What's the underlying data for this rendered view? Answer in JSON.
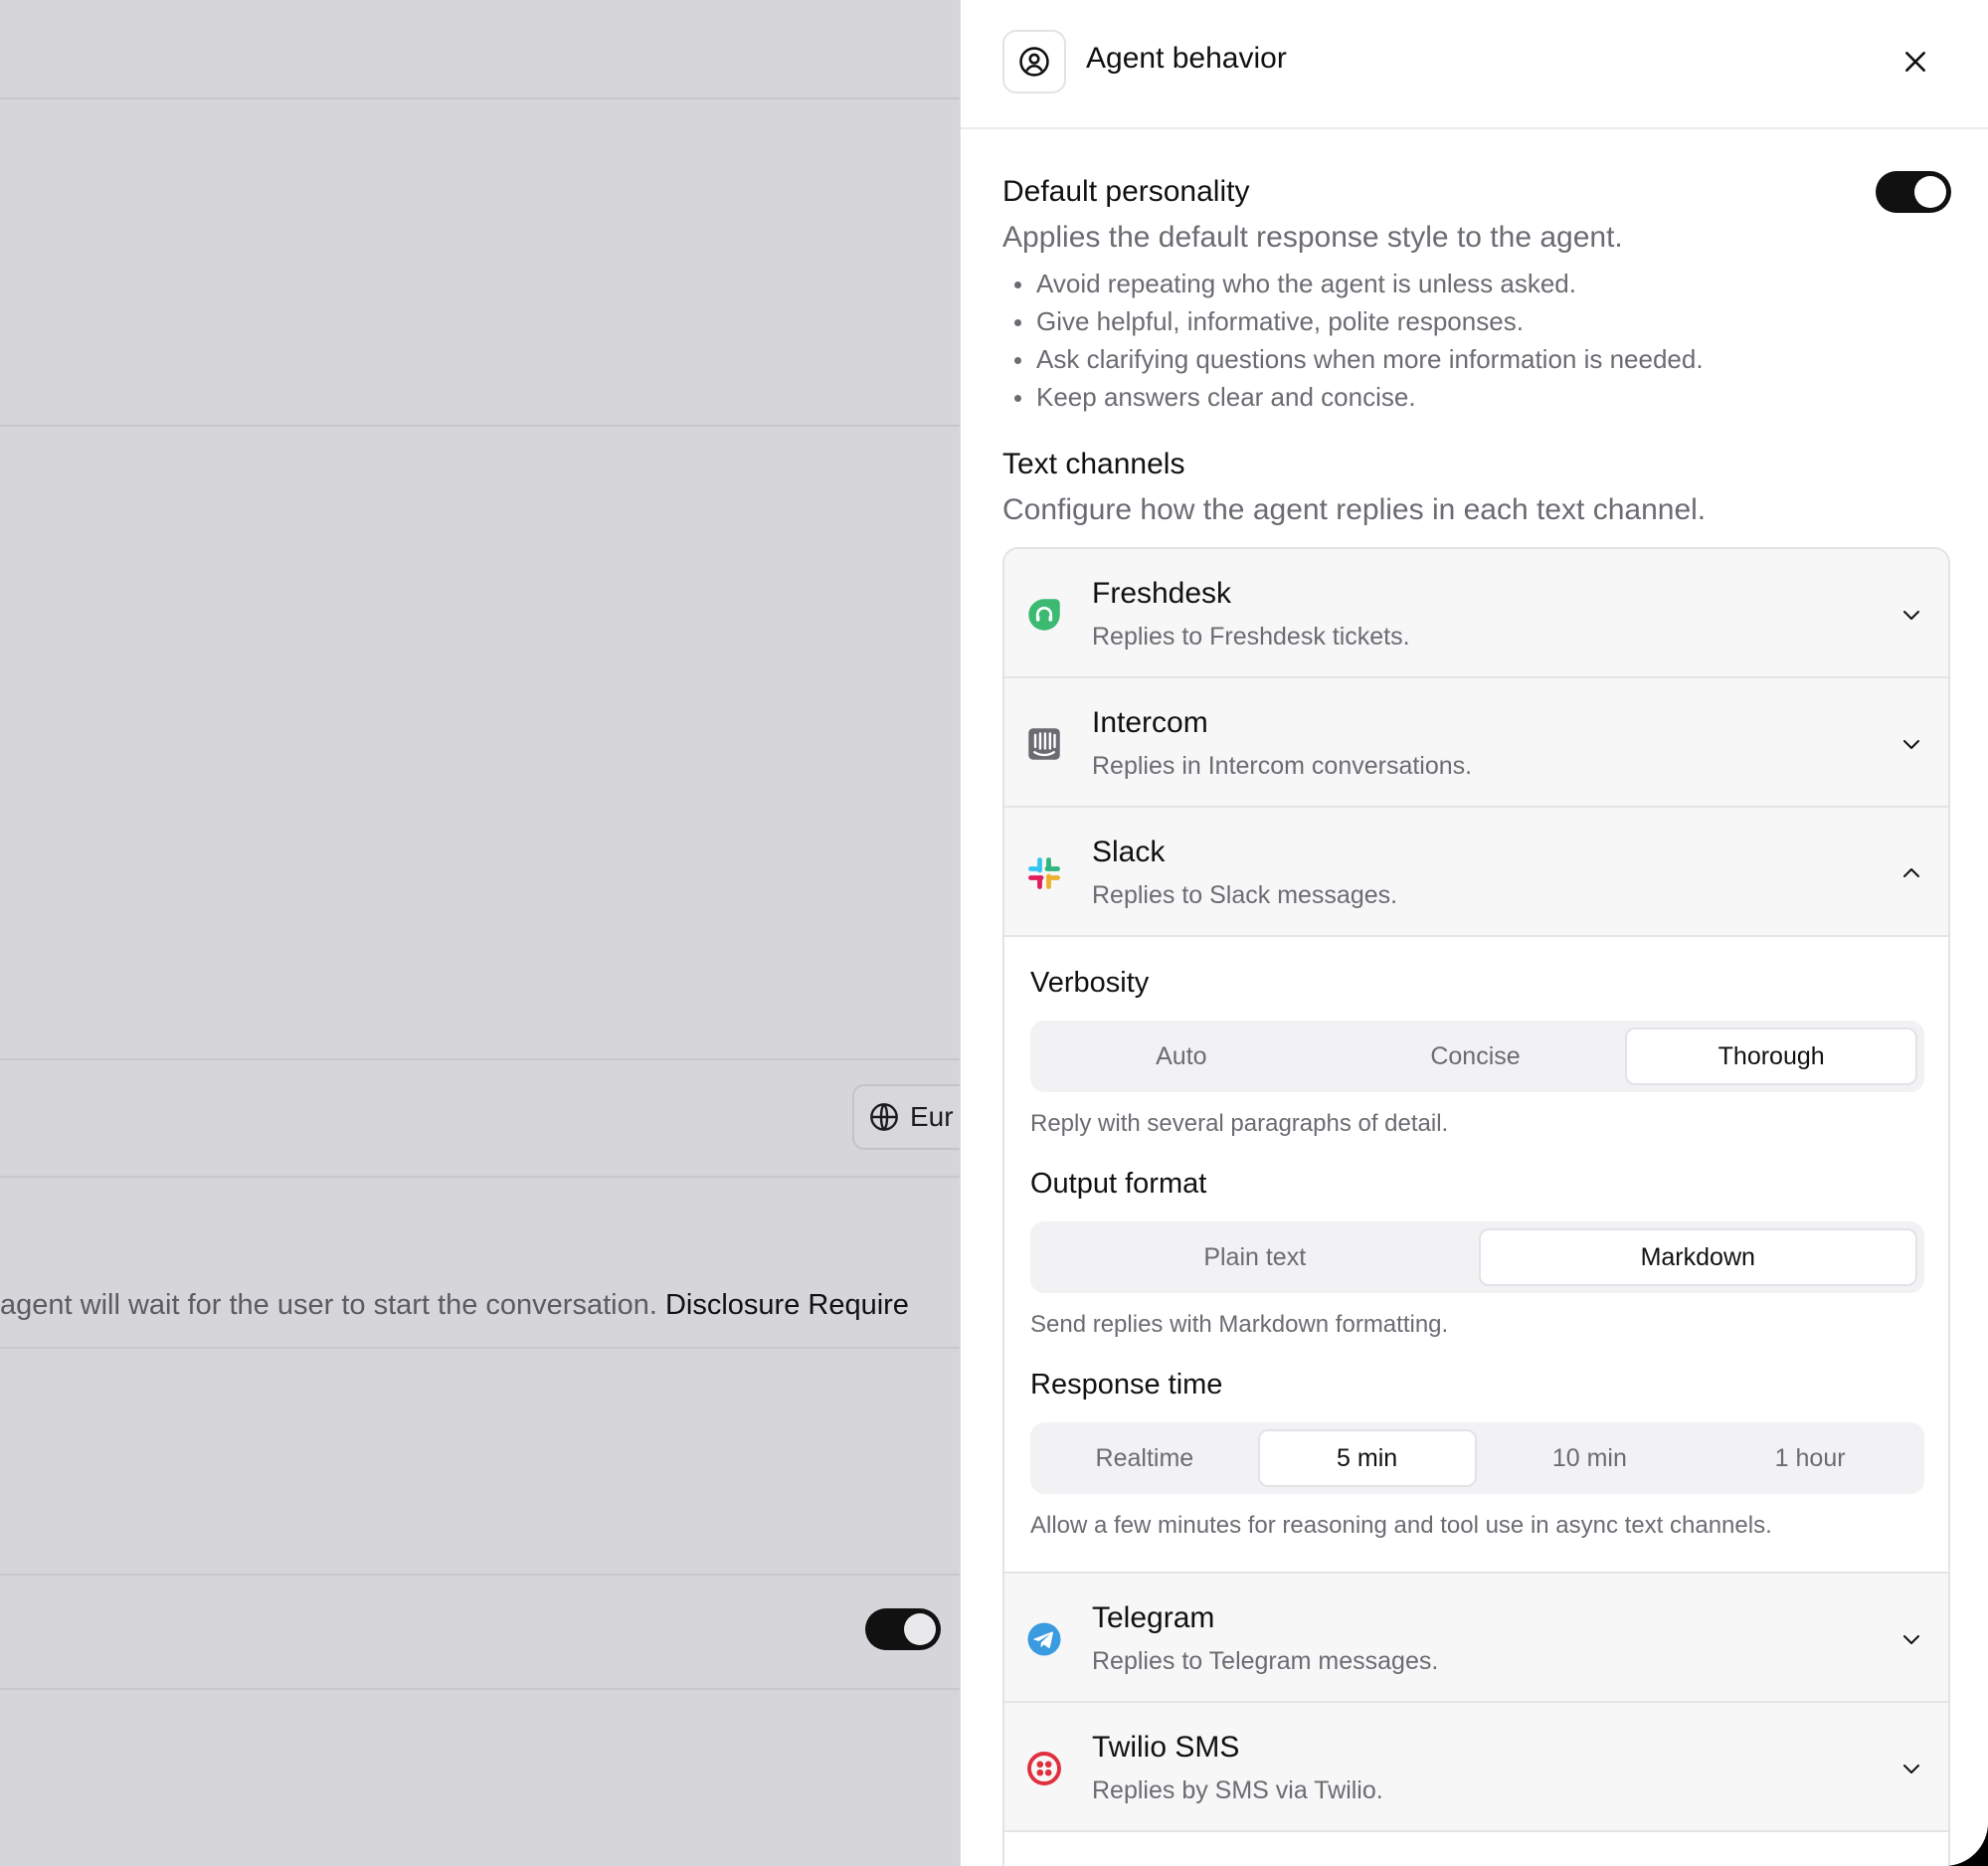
{
  "background": {
    "region_label": "Eur",
    "hint_text": "agent will wait for the user to start the conversation.",
    "hint_strong": "Disclosure Require"
  },
  "drawer": {
    "title": "Agent behavior",
    "header_icon": "user-circle-icon",
    "close_icon": "close-icon",
    "personality": {
      "title": "Default personality",
      "description": "Applies the default response style to the agent.",
      "enabled": true,
      "bullets": [
        "Avoid repeating who the agent is unless asked.",
        "Give helpful, informative, polite responses.",
        "Ask clarifying questions when more information is needed.",
        "Keep answers clear and concise."
      ]
    },
    "text_channels": {
      "title": "Text channels",
      "description": "Configure how the agent replies in each text channel.",
      "channels": [
        {
          "name": "Freshdesk",
          "description": "Replies to Freshdesk tickets.",
          "icon": "freshdesk-icon",
          "color": "#3dba72",
          "expanded": false
        },
        {
          "name": "Intercom",
          "description": "Replies in Intercom conversations.",
          "icon": "intercom-icon",
          "color": "#6b6b72",
          "expanded": false
        },
        {
          "name": "Slack",
          "description": "Replies to Slack messages.",
          "icon": "slack-icon",
          "expanded": true
        },
        {
          "name": "Telegram",
          "description": "Replies to Telegram messages.",
          "icon": "telegram-icon",
          "color": "#3a9be0",
          "expanded": false
        },
        {
          "name": "Twilio SMS",
          "description": "Replies by SMS via Twilio.",
          "icon": "twilio-icon",
          "color": "#e0303f",
          "expanded": false
        }
      ]
    },
    "slack_settings": {
      "verbosity": {
        "title": "Verbosity",
        "options": [
          "Auto",
          "Concise",
          "Thorough"
        ],
        "selected": "Thorough",
        "help": "Reply with several paragraphs of detail."
      },
      "output_format": {
        "title": "Output format",
        "options": [
          "Plain text",
          "Markdown"
        ],
        "selected": "Markdown",
        "help": "Send replies with Markdown formatting."
      },
      "response_time": {
        "title": "Response time",
        "options": [
          "Realtime",
          "5 min",
          "10 min",
          "1 hour"
        ],
        "selected": "5 min",
        "help": "Allow a few minutes for reasoning and tool use in async text channels."
      }
    }
  }
}
